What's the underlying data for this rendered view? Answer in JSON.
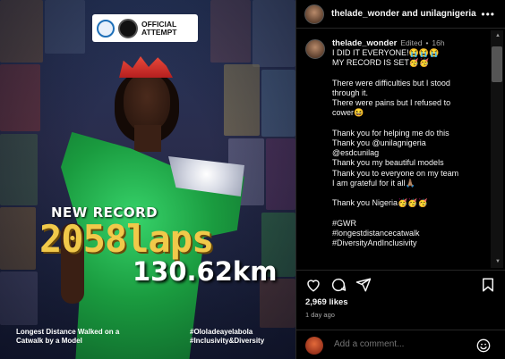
{
  "post": {
    "badge": {
      "official_line1": "OFFICIAL",
      "official_line2": "ATTEMPT"
    },
    "headline": "NEW RECORD",
    "laps": "2058laps",
    "distance": "130.62km",
    "caption_left": "Longest Distance Walked on a Catwalk by a Model",
    "caption_right_1": "#Ololadeayelabola",
    "caption_right_2": "#Inclusivity&Diversity"
  },
  "header": {
    "title": "thelade_wonder and unilagnigeria",
    "more_icon": "more-horizontal-icon"
  },
  "caption": {
    "username": "thelade_wonder",
    "edited": "Edited",
    "dot": "•",
    "age": "16h",
    "lines": [
      "I DID IT EVERYONE!😭😭😭",
      "MY RECORD IS SET🥳🥳",
      "",
      "There were difficulties but I stood",
      "through it.",
      "There were pains but I refused to",
      "cower😆",
      "",
      "Thank you for helping me do this",
      "Thank you @unilagnigeria",
      "@esdcunilag",
      "Thank you my beautiful models",
      "Thank you to everyone on my team",
      "I am grateful for it all🙏🏽",
      "",
      "Thank you Nigeria🥳🥳🥳",
      "",
      "#GWR",
      "#longestdistancecatwalk",
      "#DiversityAndInclusivity"
    ]
  },
  "actions": {
    "like_icon": "heart-icon",
    "comment_icon": "comment-icon",
    "share_icon": "send-icon",
    "save_icon": "bookmark-icon"
  },
  "likes": "2,969 likes",
  "timestamp": "1 day ago",
  "comment_box": {
    "placeholder": "Add a comment...",
    "emoji_icon": "smiley-icon"
  },
  "colors": {
    "accent_gold": "#f1c94a",
    "dress_green": "#1a9b3f",
    "background": "#000000",
    "muted": "#a8a8a8"
  }
}
